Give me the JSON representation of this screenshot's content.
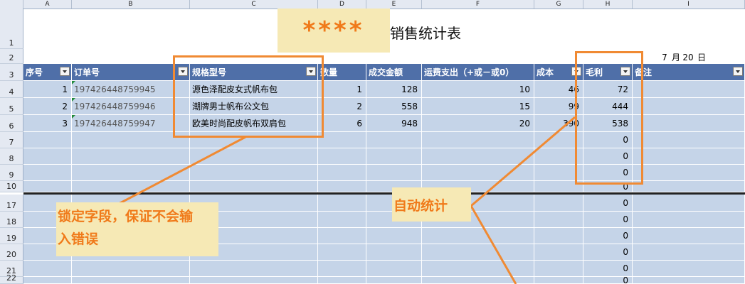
{
  "column_headers": [
    "A",
    "B",
    "C",
    "D",
    "E",
    "F",
    "G",
    "H",
    "I"
  ],
  "title": "销售统计表",
  "stars": "****",
  "date_row": {
    "month": "7",
    "month_label": "月",
    "day": "20",
    "day_label": "日"
  },
  "row_numbers": {
    "r1": "1",
    "r2": "2",
    "r3": "3",
    "r4": "4",
    "r5": "5",
    "r6": "6",
    "r7": "7",
    "r8": "8",
    "r9": "9",
    "r10": "10",
    "r17": "17",
    "r18": "18",
    "r19": "19",
    "r20": "20",
    "r21": "21",
    "r22": "22"
  },
  "headers": {
    "seq": "序号",
    "order": "订单号",
    "spec": "规格型号",
    "qty": "数量",
    "amount": "成交金额",
    "freight": "运费支出（+或－或0）",
    "cost": "成本",
    "profit": "毛利",
    "note": "备注"
  },
  "rows": [
    {
      "seq": "1",
      "order": "197426448759945",
      "spec": "源色泽配皮女式帆布包",
      "qty": "1",
      "amount": "128",
      "freight": "10",
      "cost": "46",
      "profit": "72"
    },
    {
      "seq": "2",
      "order": "197426448759946",
      "spec": "潮牌男士帆布公文包",
      "qty": "2",
      "amount": "558",
      "freight": "15",
      "cost": "99",
      "profit": "444"
    },
    {
      "seq": "3",
      "order": "197426448759947",
      "spec": "欧美时尚配皮帆布双肩包",
      "qty": "6",
      "amount": "948",
      "freight": "20",
      "cost": "390",
      "profit": "538"
    }
  ],
  "zero": "0",
  "callouts": {
    "lock_line1": "锁定字段，保证不会输",
    "lock_line2": "入错误",
    "auto": "自动统计"
  },
  "colors": {
    "header_blue": "#4f6fa8",
    "band": "#c5d4e8",
    "accent_orange": "#f08a33"
  }
}
